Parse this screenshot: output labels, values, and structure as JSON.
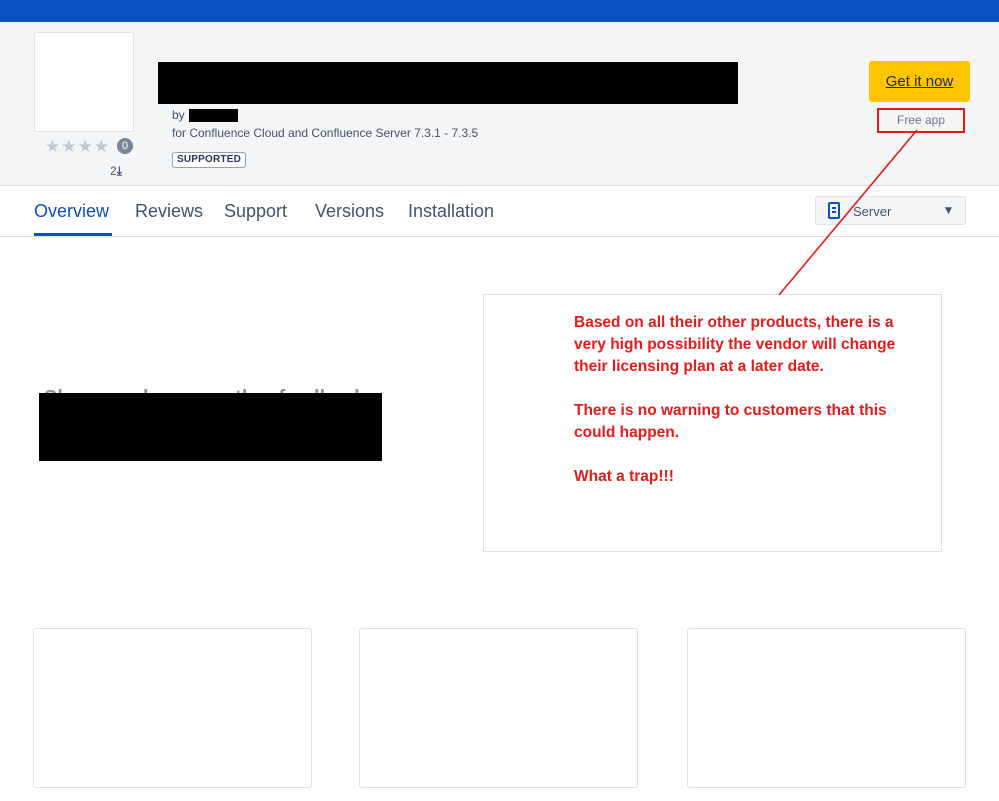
{
  "listing": {
    "by_label": "by",
    "compatibility": "for Confluence Cloud and Confluence Server 7.3.1 - 7.3.5",
    "supported_badge": "SUPPORTED",
    "stars": "★★★★",
    "review_count": "0",
    "installs": "2"
  },
  "cta": {
    "get_label": "Get it now",
    "price_label": "Free app"
  },
  "tabs": [
    {
      "label": "Overview",
      "active": true
    },
    {
      "label": "Reviews",
      "active": false
    },
    {
      "label": "Support",
      "active": false
    },
    {
      "label": "Versions",
      "active": false
    },
    {
      "label": "Installation",
      "active": false
    }
  ],
  "hosting_select": {
    "value": "Server",
    "icon": "server-icon"
  },
  "overview": {
    "share_text": "Share roadmaps, gather feedback"
  },
  "annotation": {
    "color": "#e51b1b",
    "paragraph1": "Based on all their other products, there is a very high possibility the vendor will change their licensing plan at a later date.",
    "paragraph2": "There is no warning to customers that this could happen.",
    "paragraph3": "What a trap!!!"
  },
  "colors": {
    "brand": "#0b4fc4",
    "cta": "#ffc400"
  }
}
